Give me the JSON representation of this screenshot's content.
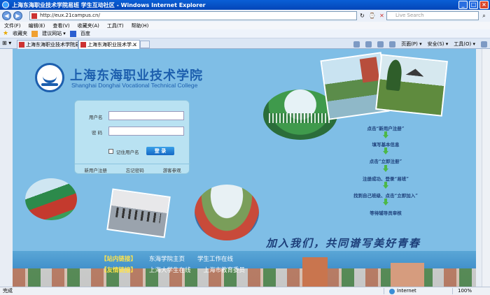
{
  "window": {
    "title": "上海东海职业技术学院易班 学生互动社区 - Windows Internet Explorer"
  },
  "address": {
    "url": "http://eux.21campus.cn/",
    "search_placeholder": "Live Search"
  },
  "menu": [
    "文件(F)",
    "编辑(E)",
    "查看(V)",
    "收藏夹(A)",
    "工具(T)",
    "帮助(H)"
  ],
  "favorites": {
    "label": "收藏夹",
    "items": [
      "建议网站 ▾",
      "百度"
    ]
  },
  "tabs": [
    {
      "label": "上海东海职业技术学院易..."
    },
    {
      "label": "上海东海职业技术学..."
    }
  ],
  "commands": [
    "页面(P) ▾",
    "安全(S) ▾",
    "工具(O) ▾"
  ],
  "page": {
    "school_cn": "上海东海职业技术学院",
    "school_en": "Shanghai Donghai Vocational Technical College",
    "login": {
      "username_label": "用户名",
      "password_label": "密  码",
      "remember_label": "记住用户名",
      "submit_label": "登 录",
      "links": [
        "新用户注册",
        "忘记密码",
        "游客参观"
      ]
    },
    "steps": [
      "点击“新用户注册”",
      "填写基本信息",
      "点击“立即注册”",
      "注册成功、登录“易班”",
      "找到自己班级、点击“立即加入”",
      "等待辅导员审核"
    ],
    "slogan": "加入我们，共同谱写美好青春",
    "links_band": {
      "internal_tag": "【站内链接】",
      "internal": [
        "东海学院主页",
        "学生工作在线"
      ],
      "friend_tag": "【友情链接】",
      "friend": [
        "上海大学生在线",
        "上海市教育委员"
      ]
    }
  },
  "status": {
    "text": "完成",
    "zone": "Internet",
    "zoom": "100%"
  }
}
